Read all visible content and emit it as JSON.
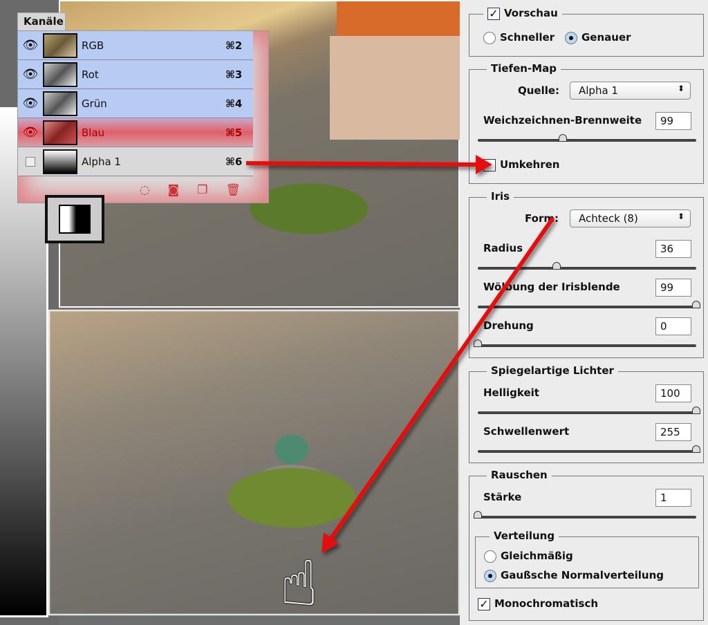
{
  "channels": {
    "tab": "Kanäle",
    "rows": [
      {
        "name": "RGB",
        "shortcut": "⌘2",
        "visible": true
      },
      {
        "name": "Rot",
        "shortcut": "⌘3",
        "visible": true
      },
      {
        "name": "Grün",
        "shortcut": "⌘4",
        "visible": true
      },
      {
        "name": "Blau",
        "shortcut": "⌘5",
        "visible": true
      },
      {
        "name": "Alpha 1",
        "shortcut": "⌘6",
        "visible": false
      }
    ],
    "footer_icons": [
      "load-selection-icon",
      "save-selection-icon",
      "new-channel-icon",
      "trash-icon"
    ]
  },
  "panel": {
    "preview": {
      "label": "Vorschau",
      "checked": true,
      "fast": "Schneller",
      "accurate": "Genauer",
      "selected": "Genauer"
    },
    "depth_map": {
      "title": "Tiefen-Map",
      "source_label": "Quelle:",
      "source_value": "Alpha 1",
      "focal_label": "Weichzeichnen-Brennweite",
      "focal_value": "99",
      "focal_fraction": 0.39,
      "invert_label": "Umkehren",
      "invert_checked": false
    },
    "iris": {
      "title": "Iris",
      "shape_label": "Form:",
      "shape_value": "Achteck (8)",
      "radius_label": "Radius",
      "radius_value": "36",
      "radius_fraction": 0.36,
      "curvature_label": "Wölbung der Irisblende",
      "curvature_value": "99",
      "curvature_fraction": 1.0,
      "rotation_label": "Drehung",
      "rotation_value": "0",
      "rotation_fraction": 0.0
    },
    "specular": {
      "title": "Spiegelartige Lichter",
      "brightness_label": "Helligkeit",
      "brightness_value": "100",
      "brightness_fraction": 1.0,
      "threshold_label": "Schwellenwert",
      "threshold_value": "255",
      "threshold_fraction": 1.0
    },
    "noise": {
      "title": "Rauschen",
      "amount_label": "Stärke",
      "amount_value": "1",
      "amount_fraction": 0.0,
      "distribution_title": "Verteilung",
      "uniform": "Gleichmäßig",
      "gaussian": "Gaußsche Normalverteilung",
      "selected": "Gaußsche Normalverteilung",
      "mono_label": "Monochromatisch",
      "mono_checked": true
    }
  },
  "colors": {
    "arrow": "#e81010",
    "channel_selected": "#b8cbf2",
    "highlight": "#e0606a"
  }
}
